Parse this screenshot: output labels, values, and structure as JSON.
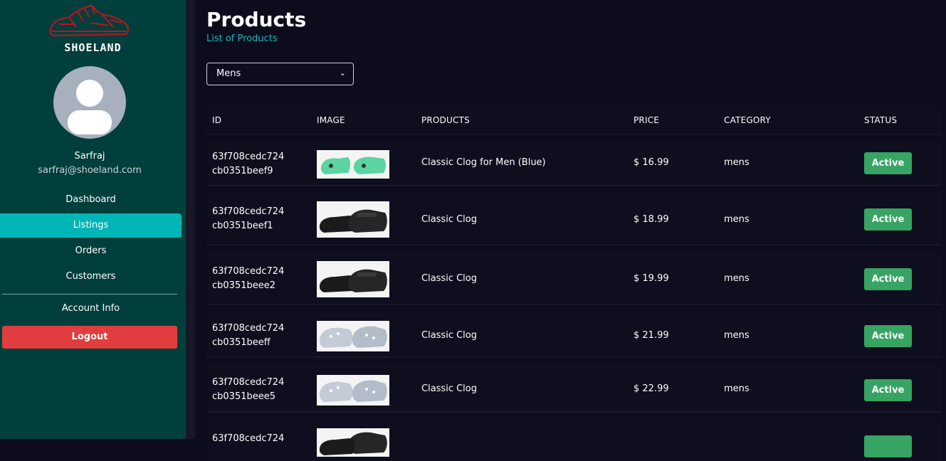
{
  "sidebar": {
    "brand": "SHOELAND",
    "user": {
      "name": "Sarfraj",
      "email": "sarfraj@shoeland.com"
    },
    "nav": [
      {
        "label": "Dashboard"
      },
      {
        "label": "Listings",
        "active": true
      },
      {
        "label": "Orders"
      },
      {
        "label": "Customers"
      }
    ],
    "account_info": "Account Info",
    "logout": "Logout"
  },
  "main": {
    "title": "Products",
    "subtitle": "List of Products",
    "category_select": {
      "value": "Mens"
    },
    "columns": [
      "ID",
      "IMAGE",
      "PRODUCTS",
      "PRICE",
      "CATEGORY",
      "STATUS"
    ],
    "rows": [
      {
        "id_line1": "63f708cedc724",
        "id_line2": "cb0351beef9",
        "image": "green-clog",
        "product": "Classic Clog for Men (Blue)",
        "price": "$ 16.99",
        "category": "mens",
        "status": "Active"
      },
      {
        "id_line1": "63f708cedc724",
        "id_line2": "cb0351beef1",
        "image": "black-sandal",
        "product": "Classic Clog",
        "price": "$ 18.99",
        "category": "mens",
        "status": "Active"
      },
      {
        "id_line1": "63f708cedc724",
        "id_line2": "cb0351beee2",
        "image": "black-sandal",
        "product": "Classic Clog",
        "price": "$ 19.99",
        "category": "mens",
        "status": "Active"
      },
      {
        "id_line1": "63f708cedc724",
        "id_line2": "cb0351beeff",
        "image": "glitter-clog",
        "product": "Classic Clog",
        "price": "$ 21.99",
        "category": "mens",
        "status": "Active"
      },
      {
        "id_line1": "63f708cedc724",
        "id_line2": "cb0351beee5",
        "image": "glitter-clog",
        "product": "Classic Clog",
        "price": "$ 22.99",
        "category": "mens",
        "status": "Active"
      },
      {
        "id_line1": "63f708cedc724",
        "id_line2": "",
        "image": "black-sandal",
        "product": "",
        "price": "",
        "category": "",
        "status": ""
      }
    ]
  },
  "colors": {
    "sidebar_bg": "#003f3c",
    "page_bg": "#0c0c1c",
    "accent": "#00b5b5",
    "logout": "#e23d3e",
    "status_active": "#37a463",
    "logo": "#c1121f"
  }
}
